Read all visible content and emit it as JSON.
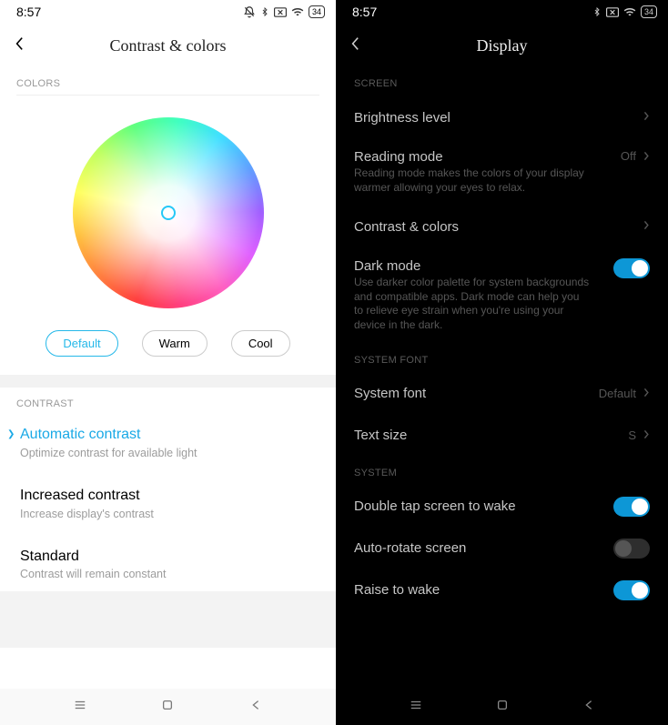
{
  "left": {
    "status": {
      "time": "8:57",
      "battery": "34"
    },
    "title": "Contrast & colors",
    "colors_header": "COLORS",
    "pills": {
      "default": "Default",
      "warm": "Warm",
      "cool": "Cool"
    },
    "contrast_header": "CONTRAST",
    "contrast_items": [
      {
        "title": "Automatic contrast",
        "sub": "Optimize contrast for available light"
      },
      {
        "title": "Increased contrast",
        "sub": "Increase display's contrast"
      },
      {
        "title": "Standard",
        "sub": "Contrast will remain constant"
      }
    ]
  },
  "right": {
    "status": {
      "time": "8:57",
      "battery": "34"
    },
    "title": "Display",
    "sections": {
      "screen": "SCREEN",
      "system_font": "SYSTEM FONT",
      "system": "SYSTEM"
    },
    "rows": {
      "brightness": {
        "title": "Brightness level"
      },
      "reading_mode": {
        "title": "Reading mode",
        "sub": "Reading mode makes the colors of your display warmer allowing your eyes to relax.",
        "value": "Off"
      },
      "contrast": {
        "title": "Contrast & colors"
      },
      "dark_mode": {
        "title": "Dark mode",
        "sub": "Use darker color palette for system backgrounds and compatible apps. Dark mode can help you to relieve eye strain when you're using your device in the dark."
      },
      "system_font": {
        "title": "System font",
        "value": "Default"
      },
      "text_size": {
        "title": "Text size",
        "value": "S"
      },
      "double_tap": {
        "title": "Double tap screen to wake"
      },
      "auto_rotate": {
        "title": "Auto-rotate screen"
      },
      "raise_wake": {
        "title": "Raise to wake"
      }
    }
  }
}
